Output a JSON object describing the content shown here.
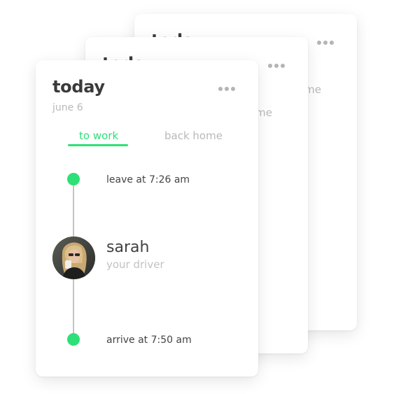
{
  "cards_back": [
    {
      "title": "today",
      "inactive_tab": "back home"
    },
    {
      "title": "today",
      "inactive_tab": "back home"
    }
  ],
  "card": {
    "title": "today",
    "date": "june 6",
    "tabs": [
      {
        "label": "to work",
        "active": true
      },
      {
        "label": "back home",
        "active": false
      }
    ],
    "timeline": {
      "start_label": "leave at 7:26 am",
      "end_label": "arrive at 7:50 am"
    },
    "driver": {
      "name": "sarah",
      "role": "your driver"
    }
  },
  "colors": {
    "accent": "#2ee077",
    "text_primary": "#3a3a3a",
    "text_muted": "#b9b9b9",
    "timeline_line": "#c4c4c4"
  },
  "icons": {
    "menu": "more-horizontal-icon"
  }
}
